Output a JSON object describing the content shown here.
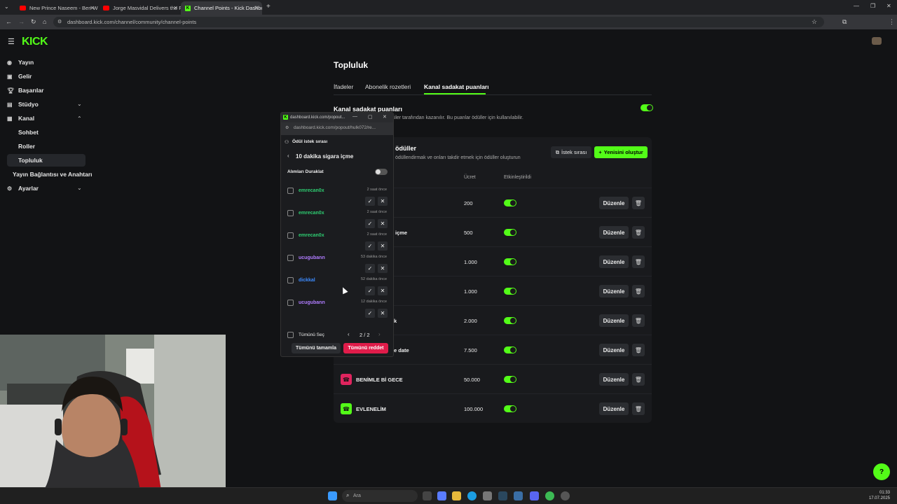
{
  "browser": {
    "tabs": [
      {
        "title": "New Prince Naseem - Ben Whit"
      },
      {
        "title": "Jorge Masvidal Delivers the Fa"
      },
      {
        "title": "Channel Points - Kick Dashboa"
      }
    ],
    "new_tab": "+",
    "url": "dashboard.kick.com/channel/community/channel-points"
  },
  "sidebar": {
    "logo": "KICK",
    "items": [
      {
        "label": "Yayın",
        "icon": "broadcast-icon"
      },
      {
        "label": "Gelir",
        "icon": "money-icon"
      },
      {
        "label": "Başarılar",
        "icon": "trophy-icon"
      },
      {
        "label": "Stüdyo",
        "icon": "studio-icon"
      },
      {
        "label": "Kanal",
        "icon": "channel-icon"
      },
      {
        "label": "Sohbet"
      },
      {
        "label": "Roller"
      },
      {
        "label": "Topluluk"
      },
      {
        "label": "Yayın Bağlantısı ve Anahtarı"
      },
      {
        "label": "Ayarlar",
        "icon": "gear-icon"
      }
    ]
  },
  "main": {
    "title": "Topluluk",
    "tabs": [
      "İfadeler",
      "Abonelik rozetleri",
      "Kanal sadakat puanları"
    ],
    "section_title": "Kanal sadakat puanları",
    "section_desc": "kanalınızda aktif olan izleyiciler tarafından kazanılır. Bu puanlar ödüller için kullanılabilir.",
    "card_title": "ödüller",
    "card_desc": "ödüllendirmak ve onları takdir etmek için ödüller oluşturun",
    "queue_button": "İstek sırası",
    "create_button": "Yenisini oluştur",
    "col_cost": "Ücret",
    "col_enabled": "Etkinleştirildi",
    "edit_label": "Düzenle",
    "rows": [
      {
        "name": "",
        "cost": "200"
      },
      {
        "name": "içme",
        "cost": "500"
      },
      {
        "name": "",
        "cost": "1.000"
      },
      {
        "name": "",
        "cost": "1.000"
      },
      {
        "name": "k",
        "cost": "2.000"
      },
      {
        "name": "e date",
        "cost": "7.500"
      },
      {
        "name": "BENİMLE Bİ GECE",
        "cost": "50.000"
      },
      {
        "name": "EVLENELİM",
        "cost": "100.000"
      }
    ]
  },
  "popup": {
    "title": "dashboard.kick.com/popout...",
    "url": "dashboard.kick.com/popout/hulk072/re...",
    "heading": "Ödül istek sırası",
    "reward": "10 dakika sigara içme",
    "pause_label": "Alımları Duraklat",
    "requests": [
      {
        "user": "emrecan0x",
        "time": "2 saat önce",
        "color": "#2ecc71"
      },
      {
        "user": "emrecan0x",
        "time": "2 saat önce",
        "color": "#2ecc71"
      },
      {
        "user": "emrecan0x",
        "time": "2 saat önce",
        "color": "#2ecc71"
      },
      {
        "user": "ucugubann",
        "time": "53 dakika önce",
        "color": "#b07cff"
      },
      {
        "user": "dickkal",
        "time": "52 dakika önce",
        "color": "#3d8bff"
      },
      {
        "user": "ucugubann",
        "time": "12 dakika önce",
        "color": "#b07cff"
      }
    ],
    "select_all": "Tümünü Seç",
    "page": "2 / 2",
    "approve_all": "Tümünü tamamla",
    "reject_all": "Tümünü reddet"
  },
  "taskbar": {
    "search_placeholder": "Ara",
    "time": "01:33",
    "date": "17.07.2025"
  },
  "colors": {
    "accent": "#53fc18",
    "danger": "#e01c4a"
  }
}
